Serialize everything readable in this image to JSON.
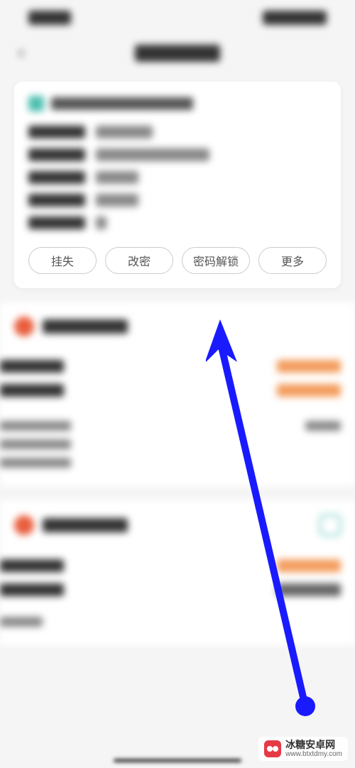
{
  "buttons": {
    "report_loss": "挂失",
    "change_password": "改密",
    "password_unlock": "密码解锁",
    "more": "更多"
  },
  "watermark": {
    "name": "冰糖安卓网",
    "url": "www.btxtdmy.com"
  }
}
